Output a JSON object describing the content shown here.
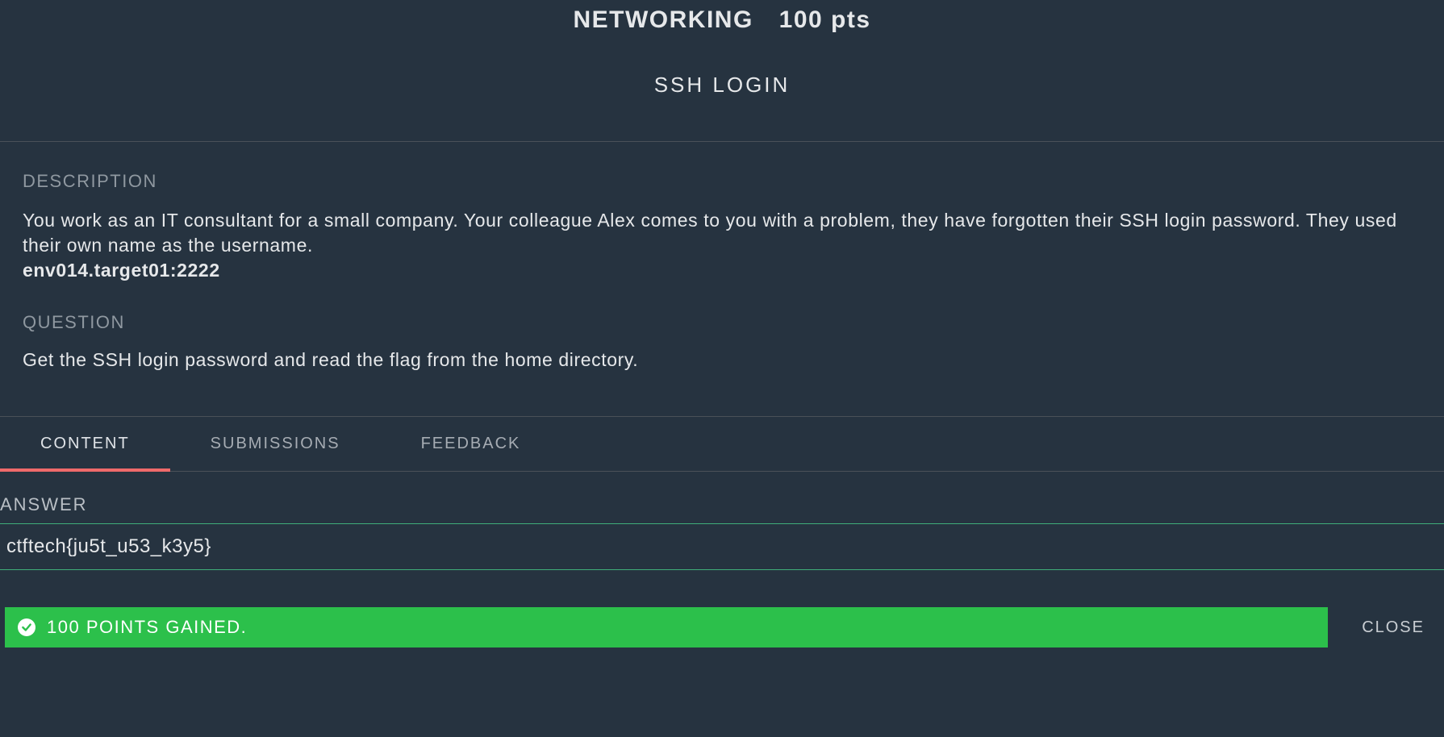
{
  "header": {
    "category": "NETWORKING",
    "points": "100 pts",
    "challenge_title": "SSH LOGIN"
  },
  "labels": {
    "description": "DESCRIPTION",
    "question": "QUESTION",
    "answer": "ANSWER"
  },
  "description": {
    "text": "You work as an IT consultant for a small company. Your colleague Alex comes to you with a problem, they have forgotten their SSH login password. They used their own name as the username.",
    "bold_line": "env014.target01:2222"
  },
  "question": {
    "text": "Get the SSH login password and read the flag from the home directory."
  },
  "tabs": [
    {
      "label": "CONTENT",
      "active": true
    },
    {
      "label": "SUBMISSIONS",
      "active": false
    },
    {
      "label": "FEEDBACK",
      "active": false
    }
  ],
  "answer": {
    "value": "ctftech{ju5t_u53_k3y5}"
  },
  "toast": {
    "message": "100 POINTS GAINED.",
    "close_label": "CLOSE"
  }
}
